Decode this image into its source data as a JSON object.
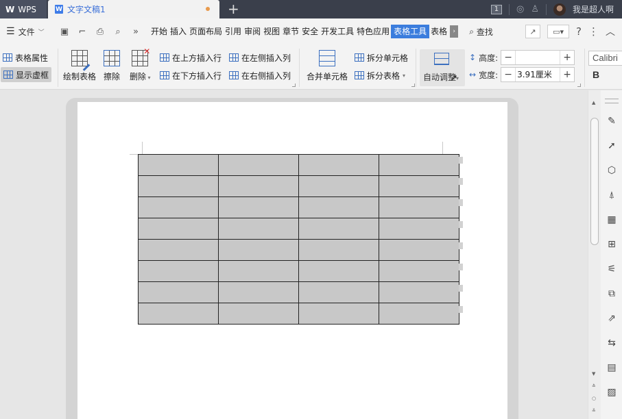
{
  "titlebar": {
    "app_name": "WPS",
    "doc_title": "文字文稿1",
    "new_tab": "+",
    "window_count": "1",
    "username": "我是超人啊"
  },
  "menubar": {
    "file_label": "文件",
    "more_chevron": "»",
    "tabs": [
      {
        "label": "开始",
        "active": false
      },
      {
        "label": "插入",
        "active": false
      },
      {
        "label": "页面布局",
        "active": false
      },
      {
        "label": "引用",
        "active": false
      },
      {
        "label": "审阅",
        "active": false
      },
      {
        "label": "视图",
        "active": false
      },
      {
        "label": "章节",
        "active": false
      },
      {
        "label": "安全",
        "active": false
      },
      {
        "label": "开发工具",
        "active": false
      },
      {
        "label": "特色应用",
        "active": false
      },
      {
        "label": "表格工具",
        "active": true
      },
      {
        "label": "表格",
        "active": false
      }
    ],
    "find_label": "查找",
    "help": "?",
    "more": "⋮"
  },
  "ribbon": {
    "table_props": "表格属性",
    "show_gridlines": "显示虚框",
    "draw_table": "绘制表格",
    "erase": "擦除",
    "delete": "删除",
    "insert_row_above": "在上方插入行",
    "insert_row_below": "在下方插入行",
    "insert_col_left": "在左侧插入列",
    "insert_col_right": "在右侧插入列",
    "merge_cells": "合并单元格",
    "split_cells": "拆分单元格",
    "split_table": "拆分表格",
    "auto_fit": "自动调整",
    "height_label": "高度:",
    "height_value": "",
    "width_label": "宽度:",
    "width_value": "3.91厘米",
    "font_name": "Calibri",
    "bold": "B"
  },
  "colors": {
    "titlebar_bg": "#3a3f4b",
    "accent": "#3b7ddd",
    "table_cell": "#c8c8c8",
    "unsaved_dot": "#e89a4c"
  },
  "table": {
    "rows": 8,
    "cols": 4
  },
  "sidebar_icons": [
    "pen-icon",
    "pointer-icon",
    "shapes-icon",
    "style-icon",
    "table-icon",
    "apps-icon",
    "sliders-icon",
    "image-gallery-icon",
    "share-icon",
    "translate-icon",
    "archive-icon",
    "picture-icon"
  ]
}
